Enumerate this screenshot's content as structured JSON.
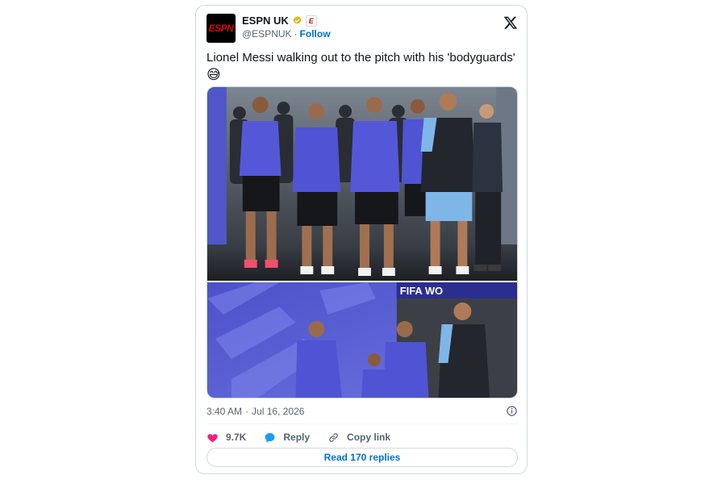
{
  "tweet": {
    "author": {
      "display_name": "ESPN UK",
      "handle": "@ESPNUK",
      "separator": "·",
      "follow_label": "Follow",
      "avatar_logo_text": "ESPN",
      "affiliate_badge_text": "E"
    },
    "text": "Lionel Messi walking out to the pitch with his 'bodyguards'",
    "emoji": "😅",
    "photos": [
      {
        "description_icon": "photo-players-tunnel-lineup"
      },
      {
        "description_icon": "photo-players-walking-fifa-tunnel"
      }
    ],
    "photo_signage_text": "FIFA WO",
    "time": "3:40 AM",
    "time_separator": "·",
    "date": "Jul 16, 2026",
    "actions": {
      "likes": "9.7K",
      "reply_label": "Reply",
      "copy_link_label": "Copy link"
    },
    "read_replies_label": "Read 170 replies"
  },
  "colors": {
    "accent": "#006fd6",
    "like": "#f91880",
    "reply": "#1d9bf0",
    "verified": "#e2b719",
    "espn_red": "#d50a0a",
    "border": "#cfd9de",
    "muted_text": "#536471"
  },
  "icons": {
    "verified": "verified-badge-icon",
    "x_logo": "x-logo-icon",
    "info": "info-icon",
    "like": "heart-icon",
    "reply": "speech-bubble-icon",
    "copy_link": "link-icon"
  }
}
